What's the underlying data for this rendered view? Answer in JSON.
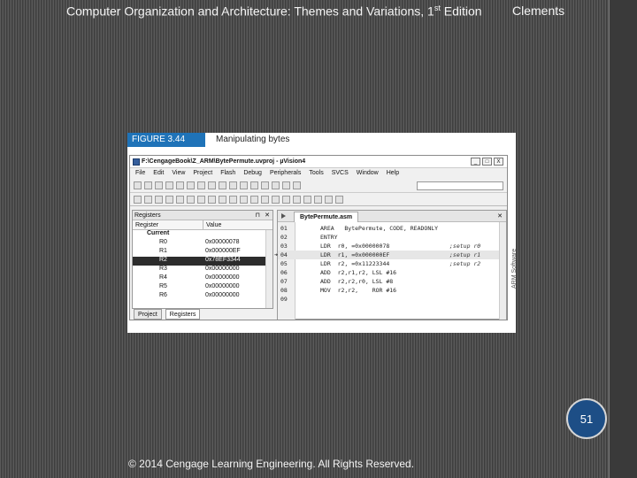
{
  "slide": {
    "header_title": "Computer Organization and Architecture: Themes and Variations, 1",
    "header_title_sup": "st",
    "header_title_tail": " Edition",
    "header_author": "Clements",
    "footer": "© 2014 Cengage Learning Engineering. All Rights Reserved.",
    "page_number": "51"
  },
  "figure": {
    "label": "FIGURE 3.44",
    "title": "Manipulating bytes",
    "credit": "ARM Software"
  },
  "ide": {
    "window_title": "F:\\CengageBook\\Z_ARM\\BytePermute.uvproj - µVision4",
    "window_buttons": [
      "_",
      "□",
      "X"
    ],
    "menu": [
      "File",
      "Edit",
      "View",
      "Project",
      "Flash",
      "Debug",
      "Peripherals",
      "Tools",
      "SVCS",
      "Window",
      "Help"
    ],
    "registers_pane": {
      "title": "Registers",
      "col_register": "Register",
      "col_value": "Value",
      "group": "Current",
      "rows": [
        {
          "name": "R0",
          "value": "0x00000078"
        },
        {
          "name": "R1",
          "value": "0x000000EF"
        },
        {
          "name": "R2",
          "value": "0x78EF3344"
        },
        {
          "name": "R3",
          "value": "0x00000000"
        },
        {
          "name": "R4",
          "value": "0x00000000"
        },
        {
          "name": "R5",
          "value": "0x00000000"
        },
        {
          "name": "R6",
          "value": "0x00000000"
        }
      ],
      "selected_row": "R2"
    },
    "bottom_tabs": [
      "Project",
      "Registers"
    ],
    "editor": {
      "file_tab": "BytePermute.asm",
      "lines": [
        {
          "num": "01",
          "code": "AREA   BytePermute, CODE, READONLY",
          "comment": ""
        },
        {
          "num": "02",
          "code": "ENTRY",
          "comment": ""
        },
        {
          "num": "03",
          "code": "LDR  r0, =0x00000078",
          "comment": ";setup r0"
        },
        {
          "num": "04",
          "code": "LDR  r1, =0x000000EF",
          "comment": ";setup r1"
        },
        {
          "num": "05",
          "code": "LDR  r2, =0x11223344",
          "comment": ";setup r2"
        },
        {
          "num": "06",
          "code": "ADD  r2,r1,r2, LSL #16",
          "comment": ""
        },
        {
          "num": "07",
          "code": "ADD  r2,r2,r0, LSL #8",
          "comment": ""
        },
        {
          "num": "08",
          "code": "MOV  r2,r2,    ROR #16",
          "comment": ""
        },
        {
          "num": "09",
          "code": "",
          "comment": ""
        }
      ],
      "current_line": "04"
    }
  }
}
